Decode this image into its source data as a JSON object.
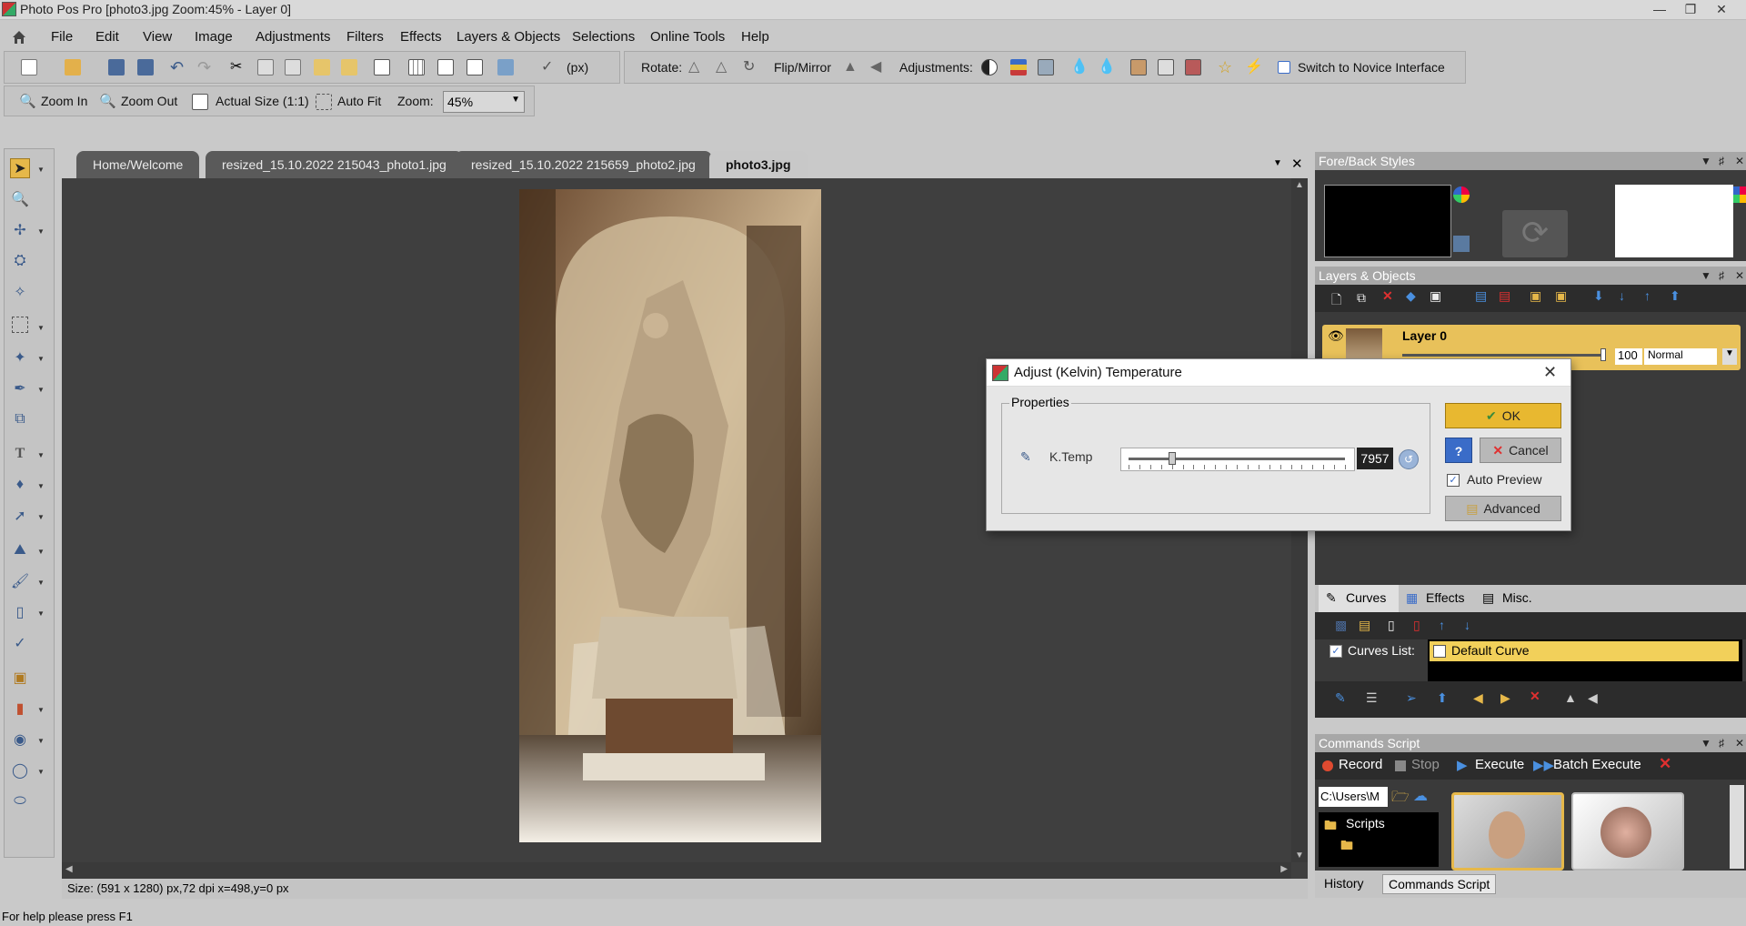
{
  "window": {
    "title": "Photo Pos Pro [photo3.jpg Zoom:45% - Layer 0]"
  },
  "menu": [
    "File",
    "Edit",
    "View",
    "Image",
    "Adjustments",
    "Filters",
    "Effects",
    "Layers & Objects",
    "Selections",
    "Online Tools",
    "Help"
  ],
  "toolbar1": {
    "units": "(px)",
    "rotate_label": "Rotate:",
    "flip_label": "Flip/Mirror",
    "adjustments_label": "Adjustments:",
    "novice_label": "Switch to Novice Interface"
  },
  "toolbar2": {
    "zoom_in": "Zoom In",
    "zoom_out": "Zoom Out",
    "actual_size": "Actual Size (1:1)",
    "auto_fit": "Auto Fit",
    "zoom_label": "Zoom:",
    "zoom_value": "45%"
  },
  "tabs": [
    {
      "label": "Home/Welcome"
    },
    {
      "label": "resized_15.10.2022 215043_photo1.jpg"
    },
    {
      "label": "resized_15.10.2022 215659_photo2.jpg"
    },
    {
      "label": "photo3.jpg"
    }
  ],
  "canvas_status": "Size: (591 x 1280) px,72 dpi   x=498,y=0 px",
  "bottom_status": "For help please press F1",
  "panels": {
    "fore_back": "Fore/Back Styles",
    "layers": {
      "title": "Layers & Objects",
      "layer_name": "Layer 0",
      "opacity": "100",
      "blend": "Normal"
    },
    "curves": {
      "tabs": [
        "Curves",
        "Effects",
        "Misc."
      ],
      "list_label": "Curves List:",
      "item": "Default Curve"
    },
    "commands": {
      "title": "Commands Script",
      "record": "Record",
      "stop": "Stop",
      "execute": "Execute",
      "batch": "Batch Execute",
      "path": "C:\\Users\\M",
      "folder": "Scripts",
      "tabs": [
        "History",
        "Commands Script"
      ]
    }
  },
  "dialog": {
    "title": "Adjust (Kelvin) Temperature",
    "group": "Properties",
    "param_label": "K.Temp",
    "param_value": "7957",
    "slider_fraction": 0.2,
    "ok": "OK",
    "cancel": "Cancel",
    "auto_preview": "Auto Preview",
    "advanced": "Advanced"
  }
}
